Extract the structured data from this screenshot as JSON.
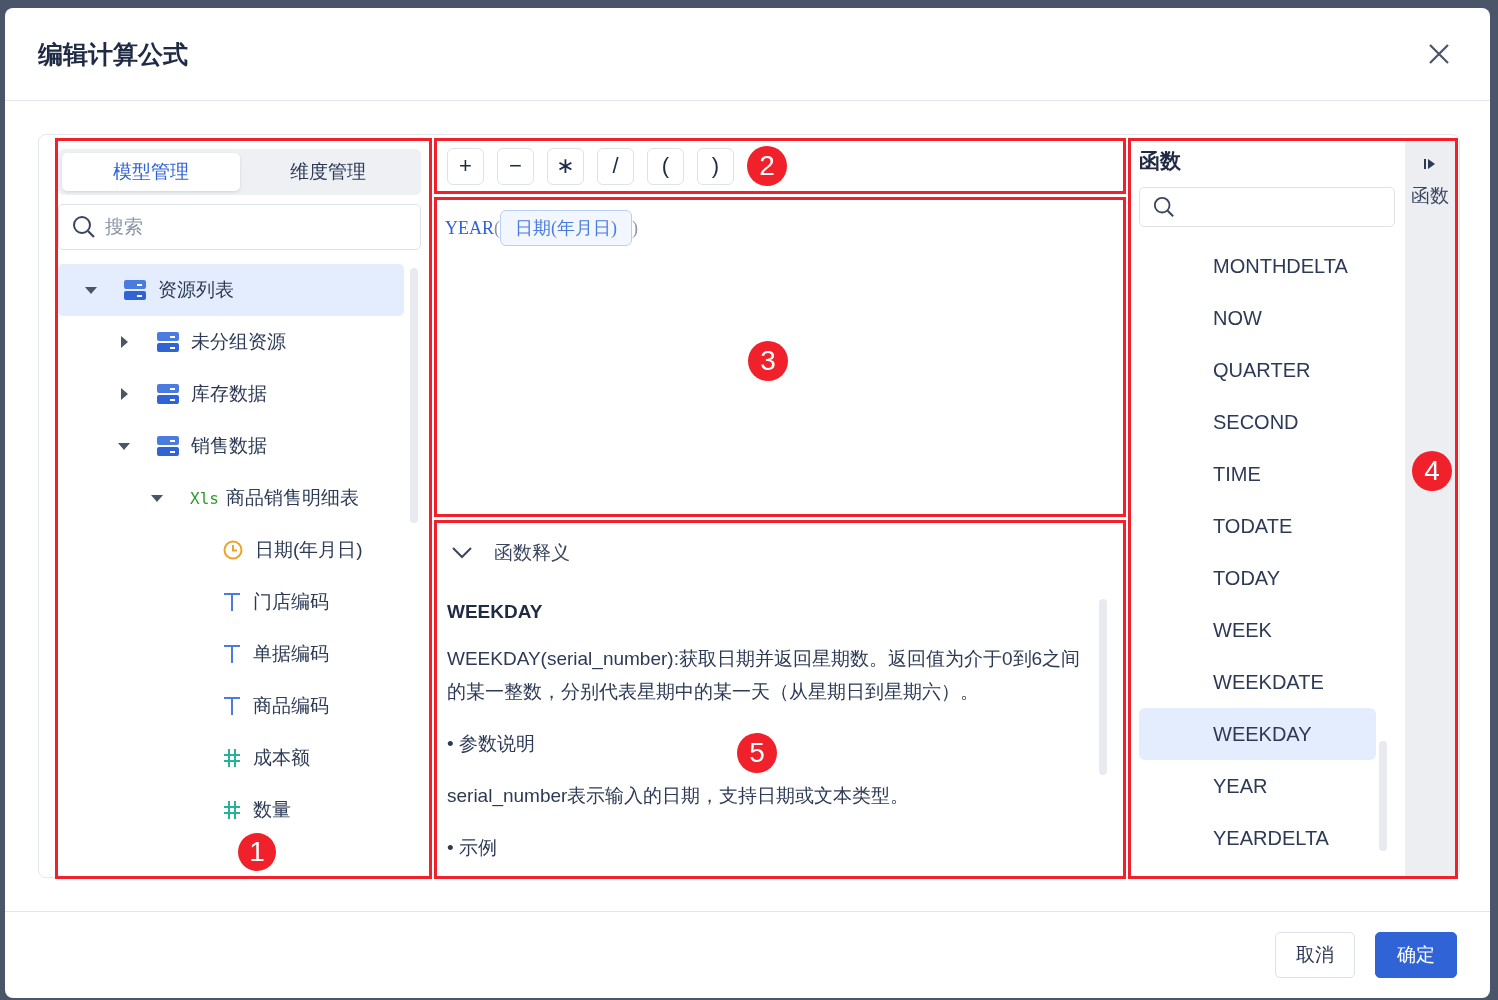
{
  "dialog": {
    "title": "编辑计算公式"
  },
  "left_panel": {
    "annotation": "1",
    "tabs": [
      {
        "label": "模型管理",
        "selected": true
      },
      {
        "label": "维度管理",
        "selected": false
      }
    ],
    "search": {
      "placeholder": "搜索"
    },
    "tree": [
      {
        "label": "资源列表",
        "kind": "folder",
        "expanded": true,
        "selected": true,
        "children": [
          {
            "label": "未分组资源",
            "kind": "folder",
            "expanded": false,
            "selected": false
          },
          {
            "label": "库存数据",
            "kind": "folder",
            "expanded": false,
            "selected": false
          },
          {
            "label": "销售数据",
            "kind": "folder",
            "expanded": true,
            "selected": false,
            "children": [
              {
                "label": "商品销售明细表",
                "kind": "sheet",
                "badge": "Xls",
                "expanded": true,
                "selected": false,
                "children": [
                  {
                    "label": "日期(年月日)",
                    "kind": "date",
                    "selected": false
                  },
                  {
                    "label": "门店编码",
                    "kind": "text",
                    "selected": false
                  },
                  {
                    "label": "单据编码",
                    "kind": "text",
                    "selected": false
                  },
                  {
                    "label": "商品编码",
                    "kind": "text",
                    "selected": false
                  },
                  {
                    "label": "成本额",
                    "kind": "number",
                    "selected": false
                  },
                  {
                    "label": "数量",
                    "kind": "number",
                    "selected": false
                  }
                ]
              }
            ]
          }
        ]
      }
    ]
  },
  "operators": {
    "annotation": "2",
    "buttons": [
      "+",
      "−",
      "∗",
      "/",
      "(",
      ")"
    ]
  },
  "editor": {
    "annotation": "3",
    "function": "YEAR",
    "open": "(",
    "token": "日期(年月日)",
    "close": ")"
  },
  "explanation": {
    "annotation": "5",
    "label": "函数释义",
    "expanded": true,
    "title": "WEEKDAY",
    "paragraphs": [
      "WEEKDAY(serial_number):获取日期并返回星期数。返回值为介于0到6之间的某一整数，分别代表星期中的某一天（从星期日到星期六）。",
      "• 参数说明",
      "serial_number表示输入的日期，支持日期或文本类型。",
      "• 示例"
    ]
  },
  "functions": {
    "annotation": "4",
    "title": "函数",
    "items": [
      {
        "label": "MONTHDELTA",
        "selected": false
      },
      {
        "label": "NOW",
        "selected": false
      },
      {
        "label": "QUARTER",
        "selected": false
      },
      {
        "label": "SECOND",
        "selected": false
      },
      {
        "label": "TIME",
        "selected": false
      },
      {
        "label": "TODATE",
        "selected": false
      },
      {
        "label": "TODAY",
        "selected": false
      },
      {
        "label": "WEEK",
        "selected": false
      },
      {
        "label": "WEEKDATE",
        "selected": false
      },
      {
        "label": "WEEKDAY",
        "selected": true
      },
      {
        "label": "YEAR",
        "selected": false
      },
      {
        "label": "YEARDELTA",
        "selected": false
      }
    ],
    "side_tab": "函数"
  },
  "footer": {
    "cancel": "取消",
    "confirm": "确定"
  }
}
